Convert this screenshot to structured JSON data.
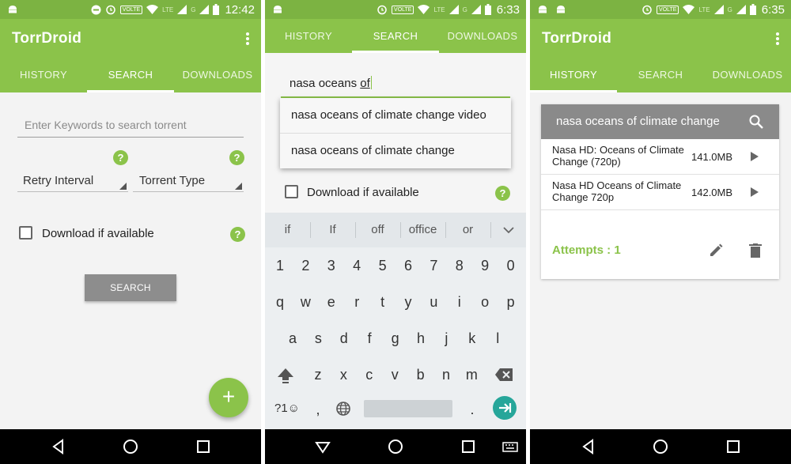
{
  "colors": {
    "primary": "#8bc34a",
    "status_bar": "#7cb342",
    "teal_enter": "#26a69a"
  },
  "status": {
    "screens": [
      {
        "time": "12:42",
        "volte": "VOLTE",
        "lte": "LTE",
        "r": "R",
        "g": "G"
      },
      {
        "time": "6:33",
        "volte": "VOLTE",
        "lte": "LTE",
        "r": "R",
        "g": "G"
      },
      {
        "time": "6:35",
        "volte": "VOLTE",
        "lte": "LTE",
        "r": "R",
        "g": "G"
      }
    ]
  },
  "app": {
    "title": "TorrDroid"
  },
  "tabs": [
    "HISTORY",
    "SEARCH",
    "DOWNLOADS"
  ],
  "search_screen": {
    "keywords_placeholder": "Enter Keywords to search torrent",
    "retry_interval": "Retry Interval",
    "torrent_type": "Torrent Type",
    "download_if_available": "Download if available",
    "search_button": "SEARCH",
    "fab": "+",
    "help": "?"
  },
  "autocomplete_screen": {
    "query_prefix": "nasa oceans ",
    "query_current_word": "of",
    "suggestions": [
      "nasa oceans of climate change video",
      "nasa oceans of climate change"
    ],
    "download_if_available": "Download if available",
    "keyboard": {
      "suggestions": [
        "if",
        "If",
        "off",
        "office",
        "or"
      ],
      "row_numbers": [
        "1",
        "2",
        "3",
        "4",
        "5",
        "6",
        "7",
        "8",
        "9",
        "0"
      ],
      "row_q": [
        "q",
        "w",
        "e",
        "r",
        "t",
        "y",
        "u",
        "i",
        "o",
        "p"
      ],
      "row_a": [
        "a",
        "s",
        "d",
        "f",
        "g",
        "h",
        "j",
        "k",
        "l"
      ],
      "row_z": [
        "z",
        "x",
        "c",
        "v",
        "b",
        "n",
        "m"
      ],
      "symbols": "?1☺",
      "comma": ",",
      "period": "."
    }
  },
  "history_screen": {
    "query": "nasa oceans of climate change",
    "results": [
      {
        "name": "Nasa HD: Oceans of Climate Change (720p)",
        "size": "141.0MB"
      },
      {
        "name": "Nasa HD Oceans of Climate Change 720p",
        "size": "142.0MB"
      }
    ],
    "attempts": "Attempts : 1"
  }
}
